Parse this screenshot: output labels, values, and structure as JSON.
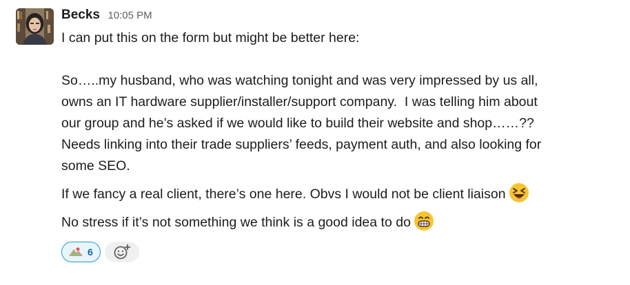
{
  "message": {
    "author": "Becks",
    "timestamp": "10:05 PM",
    "paragraphs": [
      "I can put this on the form but might be better here:",
      "So…..my husband, who was watching tonight and was very impressed by us all,\nowns an IT hardware supplier/installer/support company.  I was telling him about\nour group and he’s asked if we would like to build their website and shop……??\nNeeds linking into their trade suppliers’ feeds, payment auth, and also looking for\nsome SEO.",
      "If we fancy a real client, there’s one here. Obvs I would not be client liaison",
      "No stress if it’s not something we think is a good idea to do"
    ],
    "emojis": {
      "p3": "laughing-squint-emoji",
      "p4": "grinning-teeth-emoji"
    }
  },
  "reactions": [
    {
      "icon": "custom-reaction-icon",
      "count": "6",
      "active": true
    }
  ],
  "add_reaction": {
    "icon": "add-reaction-icon"
  },
  "colors": {
    "text": "#1d1c1d",
    "timestamp": "#616061",
    "reaction_border": "#1d9bd1",
    "reaction_bg": "#e8f5fa",
    "reaction_count": "#1264a3",
    "add_reaction_bg": "#f0f0f0"
  }
}
